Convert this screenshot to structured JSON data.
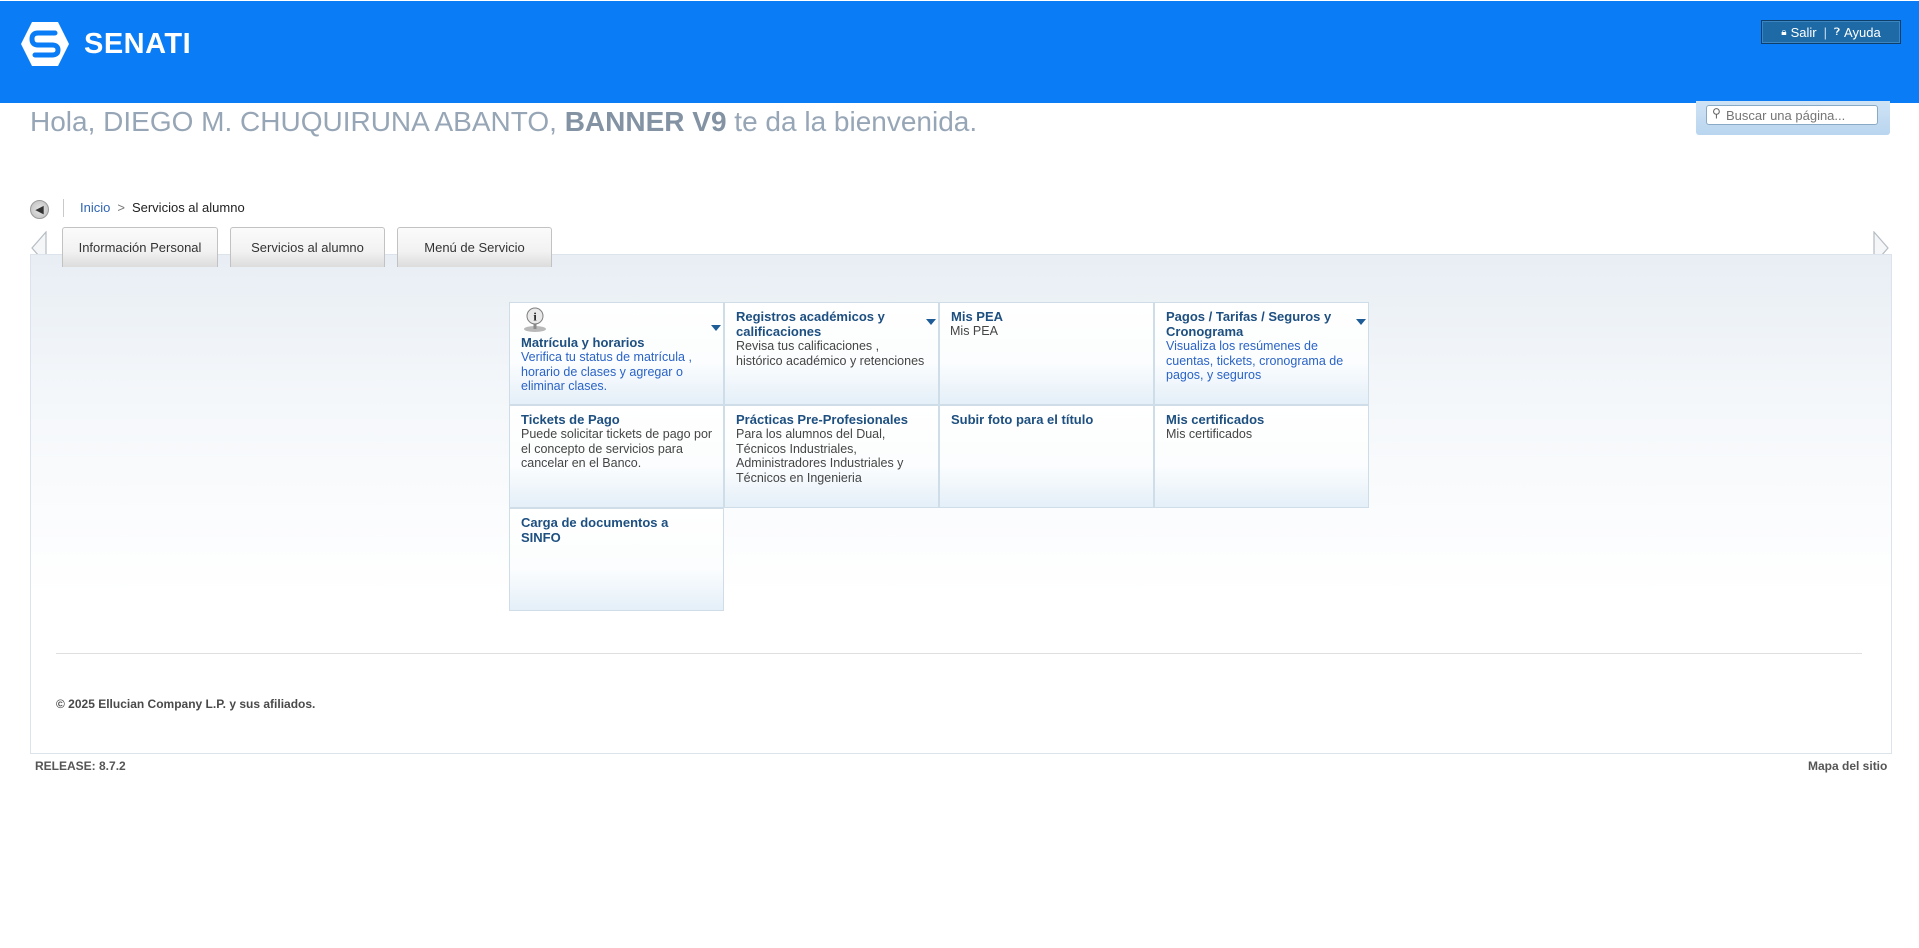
{
  "brand": {
    "name": "SENATI",
    "color": "#0a7cf5"
  },
  "header_links": {
    "logout": {
      "label": "Salir",
      "icon": "lock-icon"
    },
    "help": {
      "label": "Ayuda",
      "icon": "question-circle-icon"
    }
  },
  "welcome": {
    "prefix": "Hola, DIEGO M. CHUQUIRUNA ABANTO,",
    "product": "BANNER V9",
    "suffix": "te da la bienvenida."
  },
  "search": {
    "placeholder": "Buscar una página..."
  },
  "breadcrumb": {
    "home": "Inicio",
    "separator": ">",
    "current": "Servicios al alumno"
  },
  "tabs": [
    {
      "label": "Información Personal"
    },
    {
      "label": "Servicios al alumno"
    },
    {
      "label": "Menú de Servicio"
    }
  ],
  "cards": [
    {
      "title": "Matrícula y horarios",
      "desc": "Verifica tu status de matrícula , horario de clases y agregar o eliminar clases.",
      "has_menu": true,
      "icon": "info-icon"
    },
    {
      "title": "Registros académicos y calificaciones",
      "desc": "Revisa tus calificaciones , histórico académico y retenciones",
      "has_menu": true
    },
    {
      "title": "Mis PEA",
      "desc": "Mis PEA",
      "has_menu": false
    },
    {
      "title": "Pagos / Tarifas / Seguros y Cronograma",
      "desc": "Visualiza los resúmenes de cuentas, tickets, cronograma de pagos, y seguros",
      "has_menu": true
    },
    {
      "title": "Tickets de Pago",
      "desc": "Puede solicitar tickets de pago por el concepto de servicios para cancelar en el Banco.",
      "has_menu": false
    },
    {
      "title": "Prácticas Pre-Profesionales",
      "desc": "Para los alumnos del Dual, Técnicos Industriales, Administradores Industriales y Técnicos en Ingenieria",
      "has_menu": false
    },
    {
      "title": "Subir foto para el título",
      "desc": "",
      "has_menu": false
    },
    {
      "title": "Mis certificados",
      "desc": "Mis certificados",
      "has_menu": false
    },
    {
      "title": "Carga de documentos a SINFO",
      "desc": "",
      "has_menu": false
    }
  ],
  "footer": {
    "copyright": "© 2025 Ellucian Company L.P. y sus afiliados.",
    "release": "RELEASE: 8.7.2",
    "sitemap": "Mapa del sitio"
  }
}
